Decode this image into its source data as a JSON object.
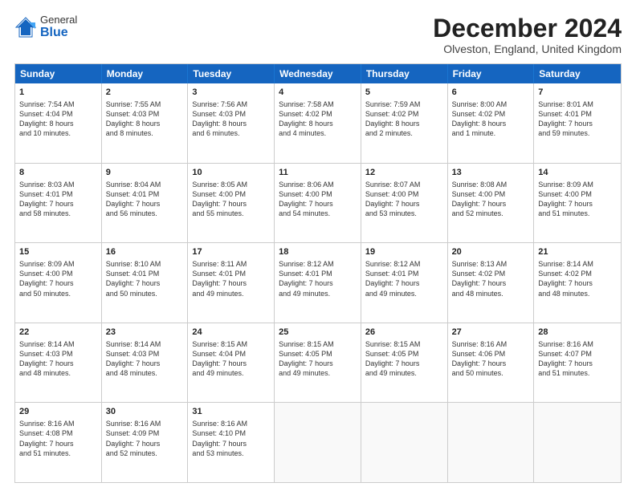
{
  "logo": {
    "general": "General",
    "blue": "Blue"
  },
  "title": "December 2024",
  "location": "Olveston, England, United Kingdom",
  "header_days": [
    "Sunday",
    "Monday",
    "Tuesday",
    "Wednesday",
    "Thursday",
    "Friday",
    "Saturday"
  ],
  "rows": [
    [
      {
        "day": "1",
        "lines": [
          "Sunrise: 7:54 AM",
          "Sunset: 4:04 PM",
          "Daylight: 8 hours",
          "and 10 minutes."
        ]
      },
      {
        "day": "2",
        "lines": [
          "Sunrise: 7:55 AM",
          "Sunset: 4:03 PM",
          "Daylight: 8 hours",
          "and 8 minutes."
        ]
      },
      {
        "day": "3",
        "lines": [
          "Sunrise: 7:56 AM",
          "Sunset: 4:03 PM",
          "Daylight: 8 hours",
          "and 6 minutes."
        ]
      },
      {
        "day": "4",
        "lines": [
          "Sunrise: 7:58 AM",
          "Sunset: 4:02 PM",
          "Daylight: 8 hours",
          "and 4 minutes."
        ]
      },
      {
        "day": "5",
        "lines": [
          "Sunrise: 7:59 AM",
          "Sunset: 4:02 PM",
          "Daylight: 8 hours",
          "and 2 minutes."
        ]
      },
      {
        "day": "6",
        "lines": [
          "Sunrise: 8:00 AM",
          "Sunset: 4:02 PM",
          "Daylight: 8 hours",
          "and 1 minute."
        ]
      },
      {
        "day": "7",
        "lines": [
          "Sunrise: 8:01 AM",
          "Sunset: 4:01 PM",
          "Daylight: 7 hours",
          "and 59 minutes."
        ]
      }
    ],
    [
      {
        "day": "8",
        "lines": [
          "Sunrise: 8:03 AM",
          "Sunset: 4:01 PM",
          "Daylight: 7 hours",
          "and 58 minutes."
        ]
      },
      {
        "day": "9",
        "lines": [
          "Sunrise: 8:04 AM",
          "Sunset: 4:01 PM",
          "Daylight: 7 hours",
          "and 56 minutes."
        ]
      },
      {
        "day": "10",
        "lines": [
          "Sunrise: 8:05 AM",
          "Sunset: 4:00 PM",
          "Daylight: 7 hours",
          "and 55 minutes."
        ]
      },
      {
        "day": "11",
        "lines": [
          "Sunrise: 8:06 AM",
          "Sunset: 4:00 PM",
          "Daylight: 7 hours",
          "and 54 minutes."
        ]
      },
      {
        "day": "12",
        "lines": [
          "Sunrise: 8:07 AM",
          "Sunset: 4:00 PM",
          "Daylight: 7 hours",
          "and 53 minutes."
        ]
      },
      {
        "day": "13",
        "lines": [
          "Sunrise: 8:08 AM",
          "Sunset: 4:00 PM",
          "Daylight: 7 hours",
          "and 52 minutes."
        ]
      },
      {
        "day": "14",
        "lines": [
          "Sunrise: 8:09 AM",
          "Sunset: 4:00 PM",
          "Daylight: 7 hours",
          "and 51 minutes."
        ]
      }
    ],
    [
      {
        "day": "15",
        "lines": [
          "Sunrise: 8:09 AM",
          "Sunset: 4:00 PM",
          "Daylight: 7 hours",
          "and 50 minutes."
        ]
      },
      {
        "day": "16",
        "lines": [
          "Sunrise: 8:10 AM",
          "Sunset: 4:01 PM",
          "Daylight: 7 hours",
          "and 50 minutes."
        ]
      },
      {
        "day": "17",
        "lines": [
          "Sunrise: 8:11 AM",
          "Sunset: 4:01 PM",
          "Daylight: 7 hours",
          "and 49 minutes."
        ]
      },
      {
        "day": "18",
        "lines": [
          "Sunrise: 8:12 AM",
          "Sunset: 4:01 PM",
          "Daylight: 7 hours",
          "and 49 minutes."
        ]
      },
      {
        "day": "19",
        "lines": [
          "Sunrise: 8:12 AM",
          "Sunset: 4:01 PM",
          "Daylight: 7 hours",
          "and 49 minutes."
        ]
      },
      {
        "day": "20",
        "lines": [
          "Sunrise: 8:13 AM",
          "Sunset: 4:02 PM",
          "Daylight: 7 hours",
          "and 48 minutes."
        ]
      },
      {
        "day": "21",
        "lines": [
          "Sunrise: 8:14 AM",
          "Sunset: 4:02 PM",
          "Daylight: 7 hours",
          "and 48 minutes."
        ]
      }
    ],
    [
      {
        "day": "22",
        "lines": [
          "Sunrise: 8:14 AM",
          "Sunset: 4:03 PM",
          "Daylight: 7 hours",
          "and 48 minutes."
        ]
      },
      {
        "day": "23",
        "lines": [
          "Sunrise: 8:14 AM",
          "Sunset: 4:03 PM",
          "Daylight: 7 hours",
          "and 48 minutes."
        ]
      },
      {
        "day": "24",
        "lines": [
          "Sunrise: 8:15 AM",
          "Sunset: 4:04 PM",
          "Daylight: 7 hours",
          "and 49 minutes."
        ]
      },
      {
        "day": "25",
        "lines": [
          "Sunrise: 8:15 AM",
          "Sunset: 4:05 PM",
          "Daylight: 7 hours",
          "and 49 minutes."
        ]
      },
      {
        "day": "26",
        "lines": [
          "Sunrise: 8:15 AM",
          "Sunset: 4:05 PM",
          "Daylight: 7 hours",
          "and 49 minutes."
        ]
      },
      {
        "day": "27",
        "lines": [
          "Sunrise: 8:16 AM",
          "Sunset: 4:06 PM",
          "Daylight: 7 hours",
          "and 50 minutes."
        ]
      },
      {
        "day": "28",
        "lines": [
          "Sunrise: 8:16 AM",
          "Sunset: 4:07 PM",
          "Daylight: 7 hours",
          "and 51 minutes."
        ]
      }
    ],
    [
      {
        "day": "29",
        "lines": [
          "Sunrise: 8:16 AM",
          "Sunset: 4:08 PM",
          "Daylight: 7 hours",
          "and 51 minutes."
        ]
      },
      {
        "day": "30",
        "lines": [
          "Sunrise: 8:16 AM",
          "Sunset: 4:09 PM",
          "Daylight: 7 hours",
          "and 52 minutes."
        ]
      },
      {
        "day": "31",
        "lines": [
          "Sunrise: 8:16 AM",
          "Sunset: 4:10 PM",
          "Daylight: 7 hours",
          "and 53 minutes."
        ]
      },
      {
        "day": "",
        "lines": []
      },
      {
        "day": "",
        "lines": []
      },
      {
        "day": "",
        "lines": []
      },
      {
        "day": "",
        "lines": []
      }
    ]
  ]
}
